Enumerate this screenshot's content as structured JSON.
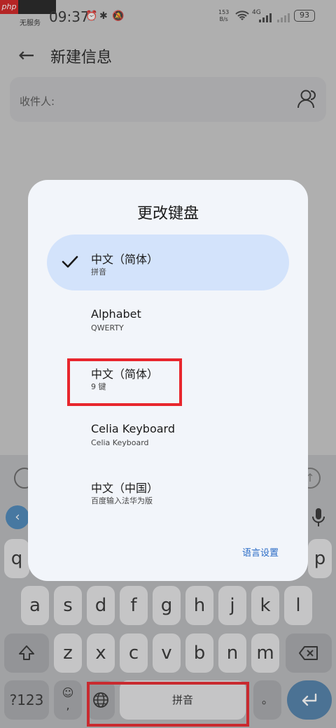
{
  "status_bar": {
    "carrier": "无服务",
    "time": "09:37",
    "speed_value": "153",
    "speed_unit": "B/s",
    "network": "4G",
    "battery": "93"
  },
  "header": {
    "title": "新建信息"
  },
  "recipient": {
    "label": "收件人:"
  },
  "dialog": {
    "title": "更改键盘",
    "options": [
      {
        "name": "中文（简体）",
        "sub": "拼音",
        "selected": true
      },
      {
        "name": "Alphabet",
        "sub": "QWERTY",
        "selected": false
      },
      {
        "name": "中文（简体）",
        "sub": "9 键",
        "selected": false
      },
      {
        "name": "Celia Keyboard",
        "sub": "Celia Keyboard",
        "selected": false
      },
      {
        "name": "中文（中国）",
        "sub": "百度输入法华为版",
        "selected": false
      }
    ],
    "settings_link": "语言设置"
  },
  "keyboard": {
    "row1_visible": [
      "q",
      "p"
    ],
    "row2": [
      "a",
      "s",
      "d",
      "f",
      "g",
      "h",
      "j",
      "k",
      "l"
    ],
    "row3": [
      "z",
      "x",
      "c",
      "v",
      "b",
      "n",
      "m"
    ],
    "num_key": "?123",
    "emoji_key": "☺",
    "comma_key": ",",
    "space_label": "拼音",
    "period_key": "。"
  },
  "colors": {
    "accent": "#2a6bc6",
    "selected_bg": "#d3e3fb",
    "annotation": "#e8262d"
  }
}
